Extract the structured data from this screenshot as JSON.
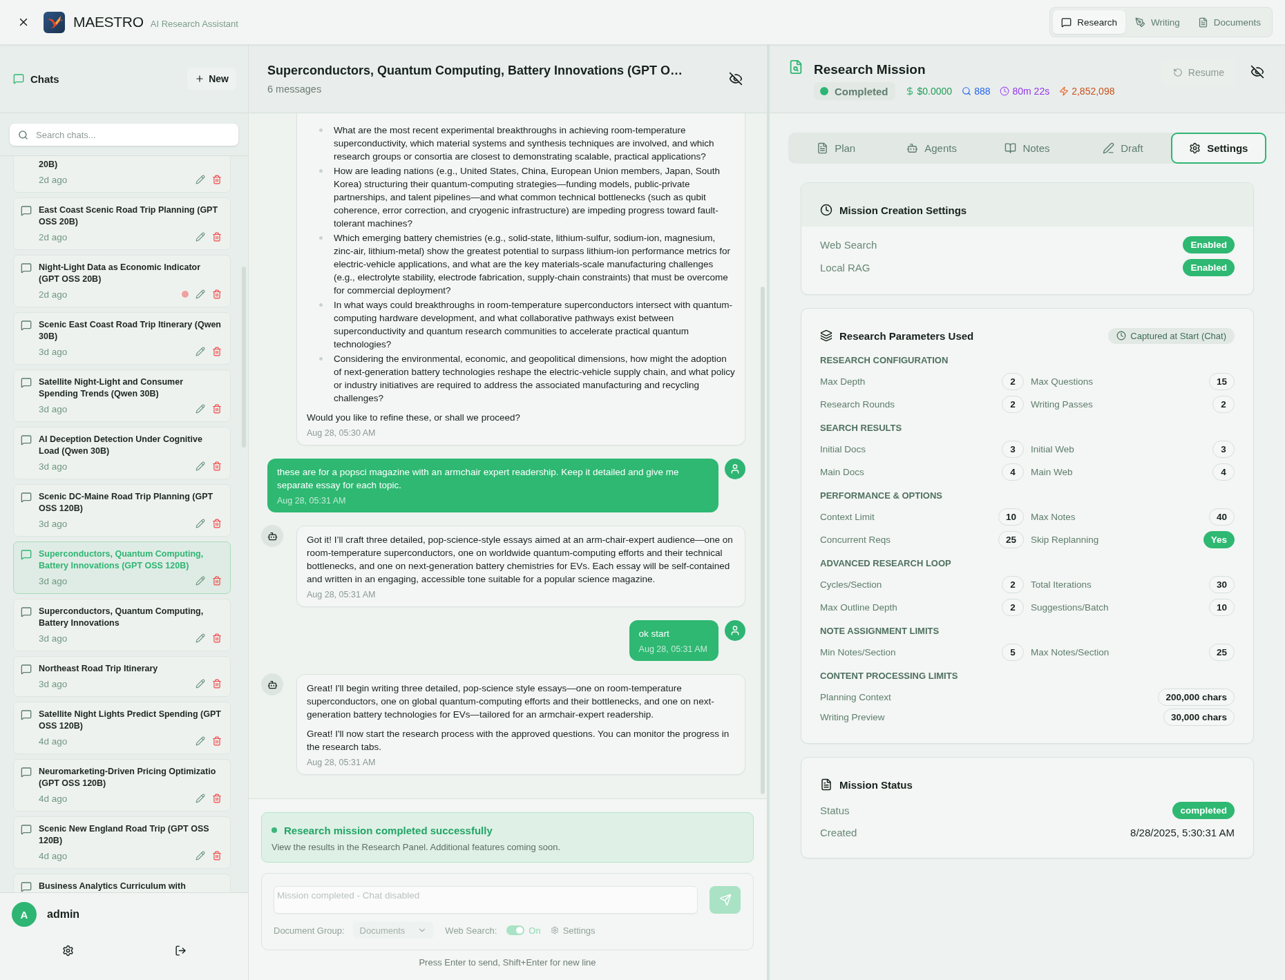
{
  "app_bar": {
    "brand": "MAESTRO",
    "subtitle": "AI Research Assistant",
    "modes": [
      {
        "kind": "research",
        "label": "Research",
        "selected": true
      },
      {
        "kind": "writing",
        "label": "Writing",
        "selected": false
      },
      {
        "kind": "documents",
        "label": "Documents",
        "selected": false
      }
    ]
  },
  "sidebar": {
    "title": "Chats",
    "new_button": "New",
    "search": {
      "placeholder": "Search chats..."
    },
    "chats": [
      {
        "title": "20B)",
        "time": "2d ago",
        "selected": false,
        "status_dot": false
      },
      {
        "title": "East Coast Scenic Road Trip Planning (GPT OSS 20B)",
        "time": "2d ago",
        "selected": false,
        "status_dot": false
      },
      {
        "title": "Night-Light Data as Economic Indicator (GPT OSS 20B)",
        "time": "2d ago",
        "selected": false,
        "status_dot": true
      },
      {
        "title": "Scenic East Coast Road Trip Itinerary (Qwen 30B)",
        "time": "3d ago",
        "selected": false,
        "status_dot": false
      },
      {
        "title": "Satellite Night-Light and Consumer Spending Trends (Qwen 30B)",
        "time": "3d ago",
        "selected": false,
        "status_dot": false
      },
      {
        "title": "AI Deception Detection Under Cognitive Load (Qwen 30B)",
        "time": "3d ago",
        "selected": false,
        "status_dot": false
      },
      {
        "title": "Scenic DC-Maine Road Trip Planning (GPT OSS 120B)",
        "time": "3d ago",
        "selected": false,
        "status_dot": false
      },
      {
        "title": "Superconductors, Quantum Computing, Battery Innovations (GPT OSS 120B)",
        "time": "3d ago",
        "selected": true,
        "status_dot": false
      },
      {
        "title": "Superconductors, Quantum Computing, Battery Innovations",
        "time": "3d ago",
        "selected": false,
        "status_dot": false
      },
      {
        "title": "Northeast Road Trip Itinerary",
        "time": "3d ago",
        "selected": false,
        "status_dot": false
      },
      {
        "title": "Satellite Night Lights Predict Spending (GPT OSS 120B)",
        "time": "4d ago",
        "selected": false,
        "status_dot": false
      },
      {
        "title": "Neuromarketing-Driven Pricing Optimizatio (GPT OSS 120B)",
        "time": "4d ago",
        "selected": false,
        "status_dot": false
      },
      {
        "title": "Scenic New England Road Trip (GPT OSS 120B)",
        "time": "4d ago",
        "selected": false,
        "status_dot": false
      },
      {
        "title": "Business Analytics Curriculum with",
        "selected": false,
        "status_dot": false
      }
    ],
    "user": {
      "initial": "A",
      "name": "admin"
    }
  },
  "chat": {
    "title": "Superconductors, Quantum Computing, Battery Innovations (GPT O…",
    "count": "6 messages",
    "messages": [
      {
        "kind": "assistant",
        "blocks": [
          {
            "kind": "bullets",
            "items": [
              "What are the most recent experimental breakthroughs in achieving room-temperature superconductivity, which material systems and synthesis techniques are involved, and which research groups or consortia are closest to demonstrating scalable, practical applications?",
              "How are leading nations (e.g., United States, China, European Union members, Japan, South Korea) structuring their quantum-computing strategies—funding models, public-private partnerships, and talent pipelines—and what common technical bottlenecks (such as qubit coherence, error correction, and cryogenic infrastructure) are impeding progress toward fault-tolerant machines?",
              "Which emerging battery chemistries (e.g., solid-state, lithium-sulfur, sodium-ion, magnesium, zinc-air, lithium-metal) show the greatest potential to surpass lithium-ion performance metrics for electric-vehicle applications, and what are the key materials-scale manufacturing challenges (e.g., electrolyte stability, electrode fabrication, supply-chain constraints) that must be overcome for commercial deployment?",
              "In what ways could breakthroughs in room-temperature superconductors intersect with quantum-computing hardware development, and what collaborative pathways exist between superconductivity and quantum research communities to accelerate practical quantum technologies?",
              "Considering the environmental, economic, and geopolitical dimensions, how might the adoption of next-generation battery technologies reshape the electric-vehicle supply chain, and what policy or industry initiatives are required to address the associated manufacturing and recycling challenges?"
            ]
          },
          {
            "kind": "paragraph",
            "text": "Would you like to refine these, or shall we proceed?"
          }
        ],
        "time": "Aug 28, 05:30 AM"
      },
      {
        "kind": "user",
        "text": "these are for a popsci magazine with an armchair expert readership. Keep it detailed and give me separate essay for each topic.",
        "time": "Aug 28, 05:31 AM"
      },
      {
        "kind": "assistant",
        "blocks": [
          {
            "kind": "paragraph",
            "text": "Got it! I’ll craft three detailed, pop-science-style essays aimed at an arm-chair-expert audience—one on room-temperature superconductors, one on worldwide quantum-computing efforts and their technical bottlenecks, and one on next-generation battery chemistries for EVs. Each essay will be self-contained and written in an engaging, accessible tone suitable for a popular science magazine."
          }
        ],
        "time": "Aug 28, 05:31 AM"
      },
      {
        "kind": "user",
        "text": "ok start",
        "time": "Aug 28, 05:31 AM"
      },
      {
        "kind": "assistant",
        "blocks": [
          {
            "kind": "paragraph",
            "text": "Great! I'll begin writing three detailed, pop-science style essays—one on room-temperature superconductors, one on global quantum-computing efforts and their bottlenecks, and one on next-generation battery technologies for EVs—tailored for an armchair-expert readership."
          },
          {
            "kind": "paragraph",
            "text": "Great! I'll now start the research process with the approved questions. You can monitor the progress in the research tabs."
          }
        ],
        "time": "Aug 28, 05:31 AM"
      }
    ],
    "banner": {
      "title": "Research mission completed successfully",
      "text": "View the results in the Research Panel. Additional features coming soon."
    },
    "composer": {
      "placeholder": "Mission completed - Chat disabled",
      "disabled": true,
      "document_group": {
        "label": "Document Group:",
        "value": "Documents"
      },
      "web_search": {
        "label": "Web Search:",
        "on": true,
        "state": "On"
      },
      "settings": "Settings"
    },
    "hint": "Press Enter to send, Shift+Enter for new line"
  },
  "mission": {
    "title": "Research Mission",
    "status": "Completed",
    "metrics": [
      {
        "kind": "cost",
        "text": "$0.0000"
      },
      {
        "kind": "queries",
        "text": "888"
      },
      {
        "kind": "duration",
        "text": "80m 22s"
      },
      {
        "kind": "tokens",
        "text": "2,852,098"
      }
    ],
    "resume": {
      "label": "Resume",
      "disabled": true
    },
    "tabs": [
      {
        "kind": "plan",
        "label": "Plan",
        "selected": false
      },
      {
        "kind": "agents",
        "label": "Agents",
        "selected": false
      },
      {
        "kind": "notes",
        "label": "Notes",
        "selected": false
      },
      {
        "kind": "draft",
        "label": "Draft",
        "selected": false
      },
      {
        "kind": "settings",
        "label": "Settings",
        "selected": true
      }
    ],
    "creation_settings": {
      "title": "Mission Creation Settings",
      "rows": [
        {
          "label": "Web Search",
          "value": "Enabled",
          "on": true
        },
        {
          "label": "Local RAG",
          "value": "Enabled",
          "on": true
        }
      ]
    },
    "parameters": {
      "title": "Research Parameters Used",
      "source": "Captured at Start (Chat)",
      "sections": [
        {
          "kind": "pairs",
          "title": "RESEARCH CONFIGURATION",
          "items": [
            {
              "kind": "count",
              "label": "Max Depth",
              "value": "2"
            },
            {
              "kind": "count",
              "label": "Max Questions",
              "value": "15"
            },
            {
              "kind": "count",
              "label": "Research Rounds",
              "value": "2"
            },
            {
              "kind": "count",
              "label": "Writing Passes",
              "value": "2"
            }
          ]
        },
        {
          "kind": "pairs",
          "title": "SEARCH RESULTS",
          "items": [
            {
              "kind": "count",
              "label": "Initial Docs",
              "value": "3"
            },
            {
              "kind": "count",
              "label": "Initial Web",
              "value": "3"
            },
            {
              "kind": "count",
              "label": "Main Docs",
              "value": "4"
            },
            {
              "kind": "count",
              "label": "Main Web",
              "value": "4"
            }
          ]
        },
        {
          "kind": "pairs",
          "title": "PERFORMANCE & OPTIONS",
          "items": [
            {
              "kind": "count",
              "label": "Context Limit",
              "value": "10"
            },
            {
              "kind": "count",
              "label": "Max Notes",
              "value": "40"
            },
            {
              "kind": "count",
              "label": "Concurrent Reqs",
              "value": "25"
            },
            {
              "kind": "flag",
              "label": "Skip Replanning",
              "value": "Yes"
            }
          ]
        },
        {
          "kind": "pairs",
          "title": "ADVANCED RESEARCH LOOP",
          "items": [
            {
              "kind": "count",
              "label": "Cycles/Section",
              "value": "2"
            },
            {
              "kind": "count",
              "label": "Total Iterations",
              "value": "30"
            },
            {
              "kind": "count",
              "label": "Max Outline Depth",
              "value": "2"
            },
            {
              "kind": "count",
              "label": "Suggestions/Batch",
              "value": "10"
            }
          ]
        },
        {
          "kind": "pairs",
          "title": "NOTE ASSIGNMENT LIMITS",
          "items": [
            {
              "kind": "count",
              "label": "Min Notes/Section",
              "value": "5"
            },
            {
              "kind": "count",
              "label": "Max Notes/Section",
              "value": "25"
            }
          ]
        },
        {
          "kind": "wide",
          "title": "CONTENT PROCESSING LIMITS",
          "items": [
            {
              "kind": "count",
              "label": "Planning Context",
              "value": "200,000 chars"
            },
            {
              "kind": "count",
              "label": "Writing Preview",
              "value": "30,000 chars"
            }
          ]
        }
      ]
    },
    "status_card": {
      "title": "Mission Status",
      "rows": [
        {
          "kind": "badge",
          "label": "Status",
          "value": "completed"
        },
        {
          "kind": "text",
          "label": "Created",
          "value": "8/28/2025, 5:30:31 AM"
        }
      ]
    }
  }
}
